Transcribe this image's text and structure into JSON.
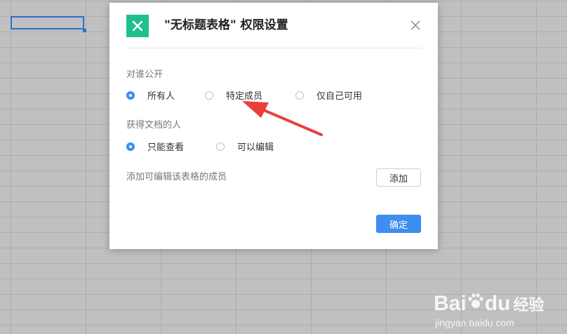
{
  "dialog": {
    "title": "\"无标题表格\" 权限设置",
    "visibility": {
      "label": "对谁公开",
      "options": [
        "所有人",
        "特定成员",
        "仅自己可用"
      ],
      "selected": "所有人"
    },
    "access": {
      "label": "获得文档的人",
      "options": [
        "只能查看",
        "可以编辑"
      ],
      "selected": "只能查看"
    },
    "add_members_label": "添加可编辑该表格的成员",
    "add_button": "添加",
    "ok_button": "确定"
  },
  "watermark": {
    "brand_a": "Bai",
    "brand_b": "du",
    "brand_c": "经验",
    "url": "jingyan.baidu.com"
  },
  "colors": {
    "accent": "#3d8ef0",
    "logo_green": "#1fbf8f",
    "arrow_red": "#e8403a",
    "selection_blue": "#2a6fcf"
  }
}
